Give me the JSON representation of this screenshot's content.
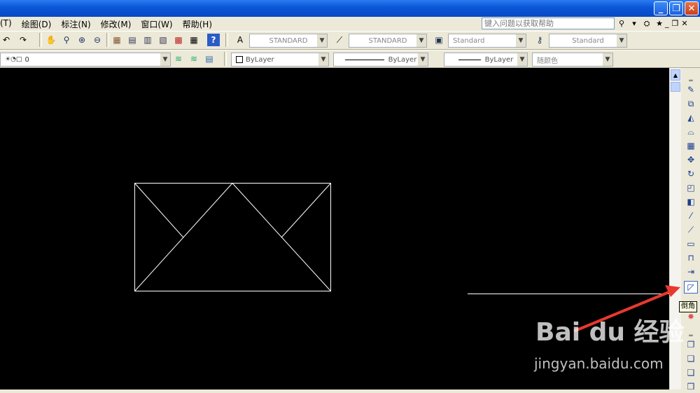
{
  "window": {
    "title": ""
  },
  "menubar": {
    "items": [
      "(T)",
      "绘图(D)",
      "标注(N)",
      "修改(M)",
      "窗口(W)",
      "帮助(H)"
    ],
    "help_placeholder": "键入问题以获取帮助"
  },
  "toolbar_styles": {
    "text_style": "STANDARD",
    "dim_style": "STANDARD",
    "table_style": "Standard",
    "multileader_style": "Standard"
  },
  "toolbar_layers": {
    "current_layer": "0",
    "color": "ByLayer",
    "linetype": "ByLayer",
    "lineweight": "ByLayer",
    "plot_style": "随颜色"
  },
  "tooltip": {
    "text": "倒角"
  },
  "watermark": {
    "logo": "Bai du 经验",
    "url": "jingyan.baidu.com"
  },
  "colors": {
    "canvas": "#000000",
    "drawing": "#ffffff",
    "arrow": "#e8392f",
    "titlebar": "#0a56d8"
  }
}
